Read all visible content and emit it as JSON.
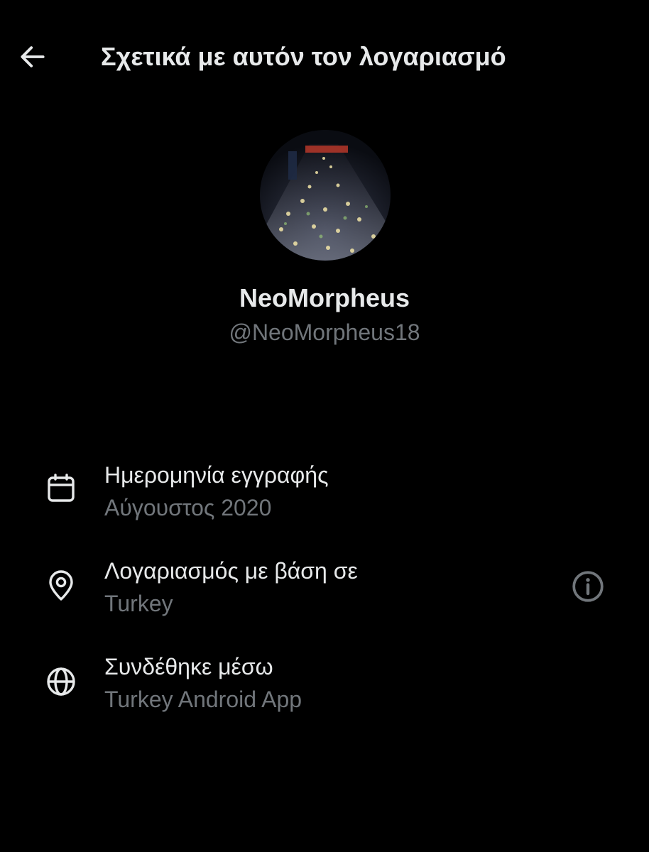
{
  "header": {
    "title": "Σχετικά με αυτόν τον λογαριασμό",
    "back_icon": "arrow-left-icon"
  },
  "profile": {
    "display_name": "NeoMorpheus",
    "handle": "@NeoMorpheus18"
  },
  "details": {
    "joined": {
      "icon": "calendar-icon",
      "label": "Ημερομηνία εγγραφής",
      "value": "Αύγουστος 2020"
    },
    "location": {
      "icon": "location-pin-icon",
      "label": "Λογαριασμός με βάση σε",
      "value": "Turkey",
      "info_icon": "info-icon"
    },
    "connected": {
      "icon": "globe-icon",
      "label": "Συνδέθηκε μέσω",
      "value": "Turkey Android App"
    }
  },
  "colors": {
    "background": "#000000",
    "primary_text": "#e7e9ea",
    "secondary_text": "#71767b"
  }
}
